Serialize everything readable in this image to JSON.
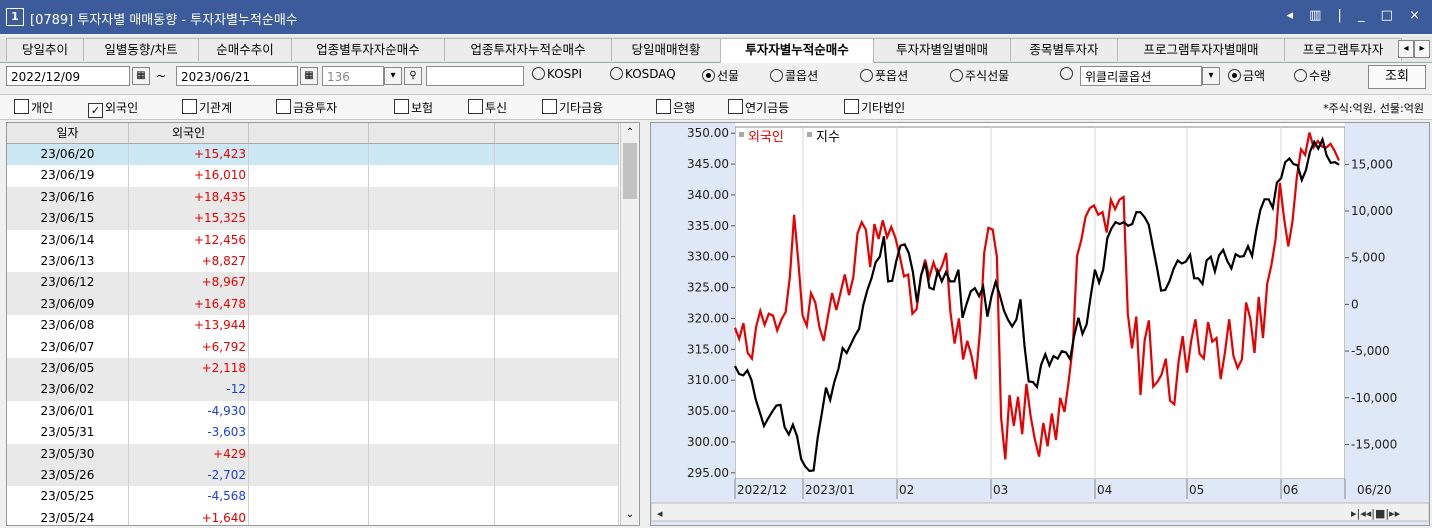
{
  "window": {
    "number": "1",
    "title": "[0789] 투자자별 매매동향 - 투자자별누적순매수",
    "controls": "◂ ▥ | _ □ ×"
  },
  "tabs": [
    {
      "label": "당일추이",
      "active": false
    },
    {
      "label": "일별동향/차트",
      "active": false
    },
    {
      "label": "순매수추이",
      "active": false
    },
    {
      "label": "업종별투자자순매수",
      "active": false
    },
    {
      "label": "업종투자자누적순매수",
      "active": false
    },
    {
      "label": "당일매매현황",
      "active": false
    },
    {
      "label": "투자자별누적순매수",
      "active": true
    },
    {
      "label": "투자자별일별매매",
      "active": false
    },
    {
      "label": "종목별투자자",
      "active": false
    },
    {
      "label": "프로그램투자자별매매",
      "active": false
    },
    {
      "label": "프로그램투자자",
      "active": false
    }
  ],
  "toolbar": {
    "start_date": "2022/12/09",
    "tilde": "~",
    "end_date": "2023/06/21",
    "count": "136",
    "market_radios": [
      {
        "label": "KOSPI",
        "on": false
      },
      {
        "label": "KOSDAQ",
        "on": false
      },
      {
        "label": "선물",
        "on": true
      },
      {
        "label": "콜옵션",
        "on": false
      },
      {
        "label": "풋옵션",
        "on": false
      },
      {
        "label": "주식선물",
        "on": false
      }
    ],
    "weekly_label": "위클리콜옵션",
    "unit_radios": [
      {
        "label": "금액",
        "on": true
      },
      {
        "label": "수량",
        "on": false
      }
    ],
    "lookup_label": "조회"
  },
  "investors": [
    {
      "label": "개인",
      "checked": false
    },
    {
      "label": "외국인",
      "checked": true
    },
    {
      "label": "기관계",
      "checked": false
    },
    {
      "label": "금융투자",
      "checked": false
    },
    {
      "label": "보험",
      "checked": false
    },
    {
      "label": "투신",
      "checked": false
    },
    {
      "label": "기타금융",
      "checked": false
    },
    {
      "label": "은행",
      "checked": false
    },
    {
      "label": "연기금등",
      "checked": false
    },
    {
      "label": "기타법인",
      "checked": false
    }
  ],
  "unit_note": "*주식:억원, 선물:억원",
  "table": {
    "headers": [
      "일자",
      "외국인"
    ],
    "rows": [
      {
        "date": "23/06/20",
        "value": "+15,423",
        "sign": "pos"
      },
      {
        "date": "23/06/19",
        "value": "+16,010",
        "sign": "pos"
      },
      {
        "date": "23/06/16",
        "value": "+18,435",
        "sign": "pos"
      },
      {
        "date": "23/06/15",
        "value": "+15,325",
        "sign": "pos"
      },
      {
        "date": "23/06/14",
        "value": "+12,456",
        "sign": "pos"
      },
      {
        "date": "23/06/13",
        "value": "+8,827",
        "sign": "pos"
      },
      {
        "date": "23/06/12",
        "value": "+8,967",
        "sign": "pos"
      },
      {
        "date": "23/06/09",
        "value": "+16,478",
        "sign": "pos"
      },
      {
        "date": "23/06/08",
        "value": "+13,944",
        "sign": "pos"
      },
      {
        "date": "23/06/07",
        "value": "+6,792",
        "sign": "pos"
      },
      {
        "date": "23/06/05",
        "value": "+2,118",
        "sign": "pos"
      },
      {
        "date": "23/06/02",
        "value": "-12",
        "sign": "neg"
      },
      {
        "date": "23/06/01",
        "value": "-4,930",
        "sign": "neg"
      },
      {
        "date": "23/05/31",
        "value": "-3,603",
        "sign": "neg"
      },
      {
        "date": "23/05/30",
        "value": "+429",
        "sign": "pos"
      },
      {
        "date": "23/05/26",
        "value": "-2,702",
        "sign": "neg"
      },
      {
        "date": "23/05/25",
        "value": "-4,568",
        "sign": "neg"
      },
      {
        "date": "23/05/24",
        "value": "+1,640",
        "sign": "pos"
      }
    ]
  },
  "chart_data": {
    "type": "line",
    "legend": [
      "외국인",
      "지수"
    ],
    "series": [
      {
        "name": "외국인",
        "axis": "right",
        "color": "#e60000",
        "values": [
          -2500,
          -3700,
          -2000,
          -5200,
          -5800,
          -2400,
          -700,
          -2200,
          -1000,
          -1200,
          -2800,
          -1600,
          -800,
          3000,
          9600,
          4500,
          -1200,
          -2300,
          1200,
          200,
          -2500,
          -3900,
          -1300,
          1200,
          -600,
          1300,
          3200,
          1000,
          2900,
          7600,
          8800,
          8000,
          4000,
          8600,
          7000,
          9000,
          7200,
          8300,
          7100,
          5200,
          3000,
          3200,
          -1000,
          -500,
          2900,
          4800,
          2900,
          4500,
          3200,
          4100,
          5500,
          -800,
          -4200,
          -1500,
          -5900,
          -3900,
          -5500,
          -8000,
          -2800,
          5500,
          8200,
          8000,
          5100,
          -12100,
          -16600,
          -9700,
          -13000,
          -9900,
          -13900,
          -8500,
          -12000,
          -14500,
          -16300,
          -12700,
          -15200,
          -11700,
          -14500,
          -10000,
          -11500,
          -8200,
          -4400,
          5200,
          6900,
          9400,
          10300,
          10600,
          9600,
          9900,
          7700,
          11200,
          10200,
          11200,
          11500,
          -1000,
          -4700,
          -1300,
          -9700,
          -3800,
          -1700,
          -8800,
          -8300,
          -7500,
          -5800,
          -10300,
          -10700,
          -6200,
          -3400,
          -7300,
          -3900,
          -1600,
          -5300,
          -5800,
          -1900,
          -4000,
          -3600,
          -8000,
          -5100,
          -1600,
          -5500,
          -6800,
          -5900,
          200,
          -1500,
          -5200,
          800,
          -3600,
          2200,
          4200,
          7000,
          13000,
          9200,
          6200,
          8900,
          13600,
          16600,
          16000,
          18400,
          16800,
          17500,
          16900,
          16800,
          17200,
          16400,
          15400
        ]
      },
      {
        "name": "지수",
        "axis": "left",
        "color": "#000000",
        "values": [
          312.3,
          311.0,
          310.8,
          311.6,
          310.0,
          306.9,
          304.8,
          302.6,
          303.8,
          304.9,
          305.9,
          306.0,
          302.4,
          301.2,
          302.8,
          300.9,
          297.2,
          296.0,
          295.3,
          295.4,
          300.7,
          304.7,
          308.8,
          306.8,
          309.7,
          311.8,
          315.2,
          314.4,
          315.8,
          317.2,
          318.3,
          322.1,
          324.6,
          326.5,
          329.1,
          330.0,
          333.3,
          326.0,
          326.1,
          329.3,
          331.8,
          332.0,
          330.6,
          327.5,
          322.6,
          327.1,
          329.0,
          325.0,
          324.7,
          327.7,
          326.0,
          327.5,
          326.0,
          326.0,
          327.9,
          320.1,
          322.4,
          324.4,
          324.9,
          323.6,
          325.1,
          320.3,
          323.6,
          325.9,
          323.8,
          321.3,
          319.8,
          318.7,
          319.8,
          323.1,
          315.4,
          309.8,
          309.7,
          308.9,
          312.5,
          314.2,
          312.4,
          313.9,
          313.5,
          314.7,
          314.5,
          313.4,
          317.2,
          320.1,
          317.5,
          319.0,
          323.7,
          327.9,
          325.8,
          327.9,
          333.0,
          334.6,
          335.6,
          335.3,
          335.6,
          335.0,
          335.3,
          337.2,
          337.2,
          336.4,
          335.2,
          331.7,
          328.2,
          324.5,
          324.6,
          326.0,
          328.0,
          329.4,
          328.9,
          329.2,
          330.3,
          326.5,
          326.5,
          325.6,
          329.4,
          330.0,
          327.6,
          330.2,
          331.1,
          329.3,
          328.1,
          330.4,
          330.0,
          330.1,
          331.7,
          330.1,
          334.3,
          337.6,
          339.3,
          339.3,
          337.9,
          342.0,
          342.7,
          345.3,
          345.9,
          345.0,
          344.8,
          342.4,
          344.0,
          347.0,
          348.6,
          347.5,
          349.0,
          346.4,
          345.2,
          345.3,
          344.9
        ]
      }
    ],
    "left_axis": {
      "ticks": [
        "350.00",
        "345.00",
        "340.00",
        "335.00",
        "330.00",
        "325.00",
        "320.00",
        "315.00",
        "310.00",
        "305.00",
        "300.00",
        "295.00"
      ],
      "range": [
        294,
        351
      ]
    },
    "right_axis": {
      "ticks": [
        "15,000",
        "10,000",
        "5,000",
        "0",
        "-5,000",
        "-10,000",
        "-15,000"
      ],
      "range": [
        -18700,
        19000
      ]
    },
    "x_ticks": [
      "2022/12",
      "2023/01",
      "02",
      "03",
      "04",
      "05",
      "06",
      "06/20"
    ],
    "grid": true,
    "legend_position": "top-left"
  }
}
